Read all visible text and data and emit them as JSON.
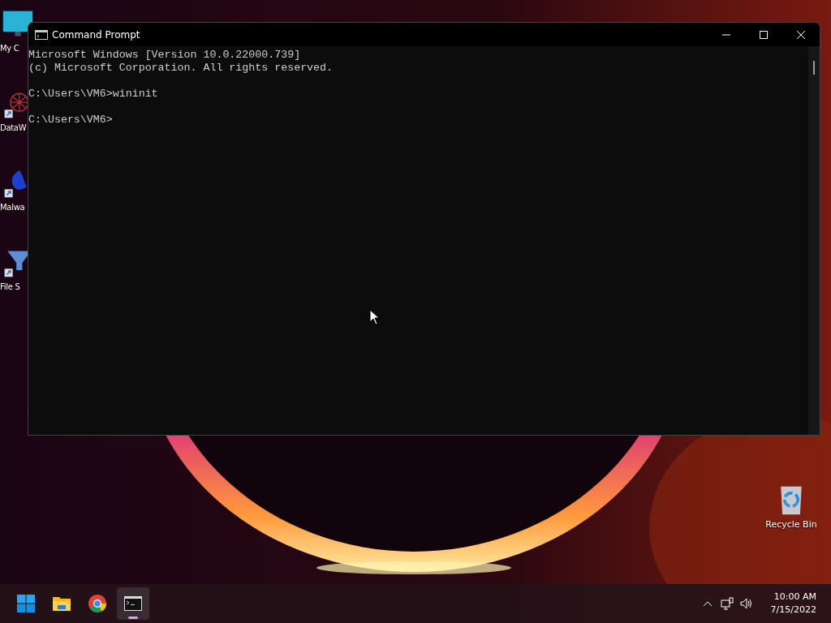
{
  "desktop": {
    "icons": [
      {
        "kind": "monitor",
        "label": "My C"
      },
      {
        "kind": "network",
        "label": "DataW"
      },
      {
        "kind": "shield",
        "label": "Malwa"
      },
      {
        "kind": "funnel",
        "label": "File S"
      },
      {
        "kind": "recycle",
        "label": "Recycle Bin"
      }
    ]
  },
  "window": {
    "title": "Command Prompt",
    "console": [
      [
        "Microsoft Windows [Version 10.0.22000.739]",
        "(c) Microsoft Corporation. All rights reserved."
      ],
      [
        "C:\\Users\\VM6>wininit"
      ],
      [
        "C:\\Users\\VM6>"
      ]
    ]
  },
  "taskbar": {
    "apps": [
      {
        "kind": "start",
        "active": false
      },
      {
        "kind": "folder",
        "active": false
      },
      {
        "kind": "chrome",
        "active": false
      },
      {
        "kind": "terminal",
        "active": true
      }
    ],
    "clock": {
      "time": "10:00 AM",
      "date": "7/15/2022"
    }
  }
}
